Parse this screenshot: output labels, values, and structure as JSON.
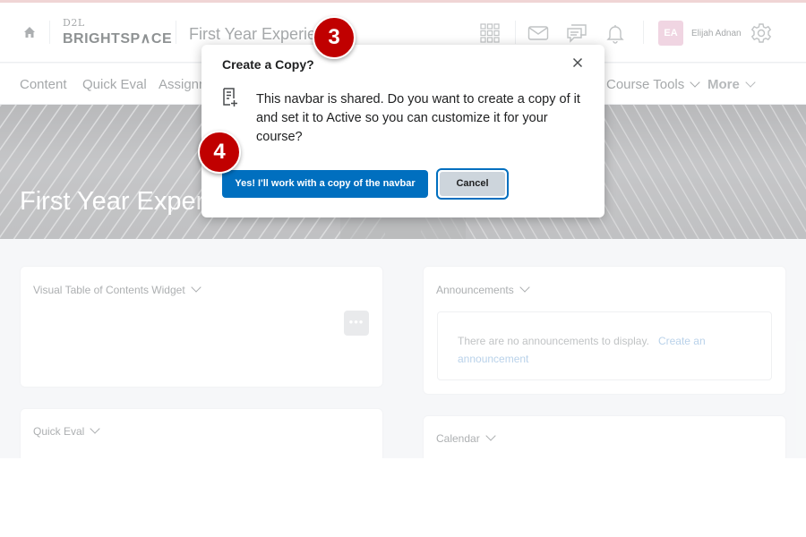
{
  "header": {
    "logo_top": "D2L",
    "logo_bottom": "BRIGHTSP∧CE",
    "course_title": "First Year Experie",
    "user_initials": "EA",
    "user_name": "Elijah Adnan"
  },
  "navbar": {
    "items": [
      {
        "label": "Content"
      },
      {
        "label": "Quick Eval"
      },
      {
        "label": "Assignm"
      },
      {
        "label": "Course Tools"
      },
      {
        "label": "More"
      }
    ]
  },
  "banner": {
    "title": "First Year Exper"
  },
  "widgets": {
    "toc_title": "Visual Table of Contents Widget",
    "more_label": "•••",
    "quick_eval_title": "Quick Eval",
    "announcements_title": "Announcements",
    "announcements_empty": "There are no announcements to display.",
    "announcements_link": "Create an announcement",
    "calendar_title": "Calendar"
  },
  "modal": {
    "title": "Create a Copy?",
    "message": "This navbar is shared. Do you want to create a copy of it and set it to Active so you can customize it for your course?",
    "primary_label": "Yes! I'll work with a copy of the navbar",
    "cancel_label": "Cancel"
  },
  "badges": {
    "step3": "3",
    "step4": "4"
  },
  "colors": {
    "primary": "#006fbf",
    "badge": "#c00000",
    "avatar": "#e7bcd0"
  },
  "icons": [
    "home-icon",
    "waffle-icon",
    "mail-icon",
    "chat-icon",
    "bell-icon",
    "gear-icon",
    "close-icon",
    "document-add-icon",
    "chevron-down-icon"
  ]
}
